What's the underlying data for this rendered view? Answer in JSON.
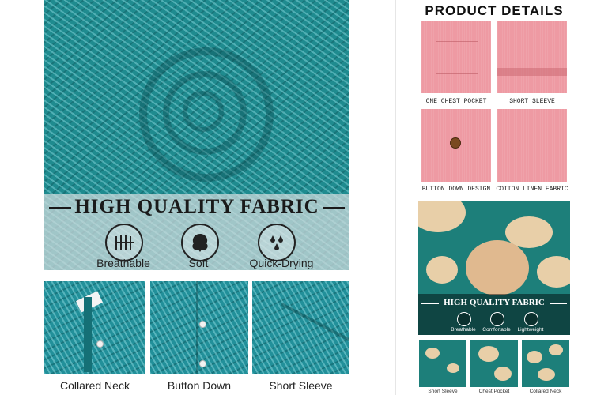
{
  "left_banner": {
    "title": "HIGH QUALITY FABRIC",
    "features": [
      {
        "label": "Breathable",
        "icon": "breathable-icon"
      },
      {
        "label": "Soft",
        "icon": "soft-icon"
      },
      {
        "label": "Quick-Drying",
        "icon": "quick-drying-icon"
      }
    ]
  },
  "bottom_details": [
    {
      "label": "Collared Neck"
    },
    {
      "label": "Button Down"
    },
    {
      "label": "Short Sleeve"
    }
  ],
  "product_details": {
    "title": "PRODUCT DETAILS",
    "items": [
      {
        "label": "ONE CHEST POCKET"
      },
      {
        "label": "SHORT SLEEVE"
      },
      {
        "label": "BUTTON DOWN DESIGN"
      },
      {
        "label": "COTTON LINEN FABRIC"
      }
    ]
  },
  "floral_panel": {
    "title": "HIGH QUALITY FABRIC",
    "features": [
      {
        "label": "Breathable",
        "icon": "breathable-icon"
      },
      {
        "label": "Comfortable",
        "icon": "comfortable-icon"
      },
      {
        "label": "Lightweight",
        "icon": "lightweight-icon"
      }
    ],
    "thumbnails": [
      {
        "label": "Short Sleeve"
      },
      {
        "label": "Chest Pocket"
      },
      {
        "label": "Collared Neck"
      }
    ]
  },
  "colors": {
    "teal_fabric": "#1f8b8f",
    "pink_fabric": "#ee9aa3",
    "floral_teal": "#1d7f7a",
    "floral_cream": "#e8cfa8"
  }
}
